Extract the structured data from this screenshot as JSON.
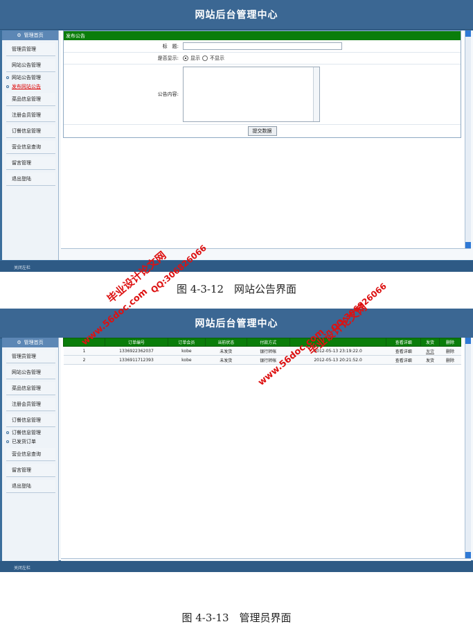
{
  "screen1": {
    "header_title": "网站后台管理中心",
    "sidebar_top": "管理首页",
    "sidebar_items_before": [
      "管理员管理",
      "网站公告管理"
    ],
    "sidebar_sub": [
      "网站公告管理",
      "发布网站公告"
    ],
    "sidebar_items_after": [
      "菜品信息管理",
      "注册会员管理",
      "订餐信息管理",
      "营业信息查询",
      "留言管理",
      "退出登陆"
    ],
    "panel_title": "发布公告",
    "form": {
      "title_label": "标　题:",
      "show_label": "是否显示:",
      "show_yes": "显示",
      "show_no": "不显示",
      "content_label": "公告内容:",
      "submit": "提交数据"
    },
    "footer": "关闭左栏"
  },
  "caption1": "图 4-3-12　网站公告界面",
  "screen2": {
    "header_title": "网站后台管理中心",
    "sidebar_top": "管理首页",
    "sidebar_items_before": [
      "管理员管理",
      "网站公告管理",
      "菜品信息管理",
      "注册会员管理",
      "订餐信息管理"
    ],
    "sidebar_sub": [
      "订餐信息管理",
      "已发货订单"
    ],
    "sidebar_items_after": [
      "营业信息查询",
      "留言管理",
      "退出登陆"
    ],
    "table": {
      "headers": [
        "",
        "订单编号",
        "订单会员",
        "当前状态",
        "付款方式",
        "",
        "查看详细",
        "发货",
        "删除"
      ],
      "rows": [
        [
          "1",
          "1336922362037",
          "kobe",
          "未发货",
          "银行转帐",
          "2012-05-13 23:19:22.0",
          "查看详细",
          "发货",
          "删除"
        ],
        [
          "2",
          "1336911712393",
          "kobe",
          "未发货",
          "银行转帐",
          "2012-05-13 20:21:52.0",
          "查看详细",
          "发货",
          "删除"
        ]
      ]
    },
    "footer": "关闭左栏"
  },
  "caption2": "图 4-3-13　管理员界面",
  "watermarks": {
    "site": "www.56doc.com",
    "qq": "QQ:306826066",
    "brand": "毕业设计论文网"
  }
}
